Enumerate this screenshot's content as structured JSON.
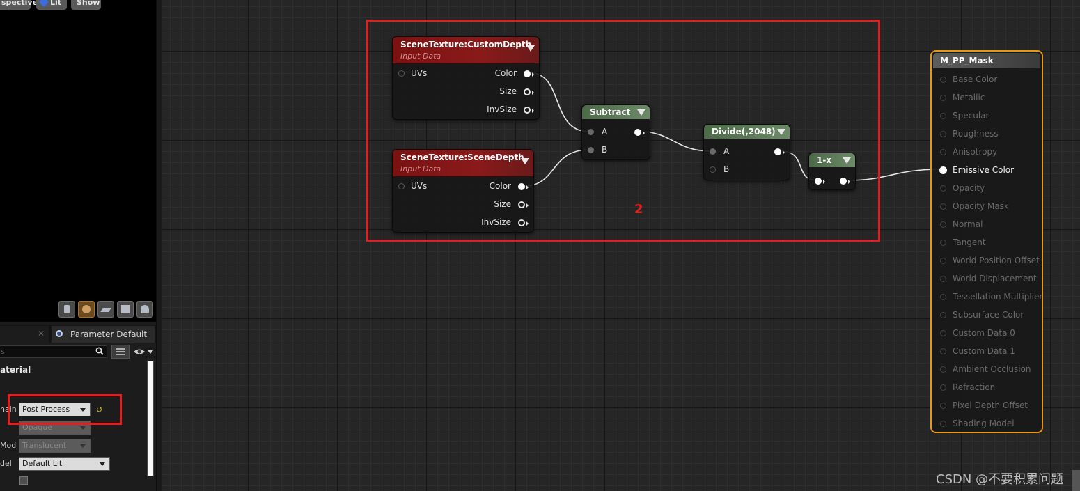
{
  "viewport": {
    "buttons": {
      "perspective": "spective",
      "lit": "Lit",
      "show": "Show"
    },
    "preview_shapes": [
      "cylinder-icon",
      "sphere-icon",
      "plane-icon",
      "cube-icon",
      "teapot-icon"
    ]
  },
  "details_panel": {
    "tab_param_label": "Parameter Default",
    "search_placeholder": "s",
    "section_heading": "aterial",
    "rows": [
      {
        "label": "nain",
        "value": "Post Process",
        "enabled": true
      },
      {
        "label": "",
        "value": "Opaque",
        "enabled": false
      },
      {
        "label": "Mod",
        "value": "Translucent",
        "enabled": false
      },
      {
        "label": "del",
        "value": "Default Lit",
        "enabled": true
      }
    ]
  },
  "graph": {
    "annotation_number": "2",
    "nodes": {
      "custom_depth": {
        "title": "SceneTexture:CustomDepth",
        "subtitle": "Input Data",
        "in_pins": [
          "UVs"
        ],
        "out_pins": [
          "Color",
          "Size",
          "InvSize"
        ]
      },
      "scene_depth": {
        "title": "SceneTexture:SceneDepth",
        "subtitle": "Input Data",
        "in_pins": [
          "UVs"
        ],
        "out_pins": [
          "Color",
          "Size",
          "InvSize"
        ]
      },
      "subtract": {
        "title": "Subtract",
        "in_pins": [
          "A",
          "B"
        ]
      },
      "divide": {
        "title": "Divide(,2048)",
        "in_pins": [
          "A",
          "B"
        ]
      },
      "one_minus": {
        "title": "1-x"
      }
    },
    "result_node": {
      "title": "M_PP_Mask",
      "pins": [
        "Base Color",
        "Metallic",
        "Specular",
        "Roughness",
        "Anisotropy",
        "Emissive Color",
        "Opacity",
        "Opacity Mask",
        "Normal",
        "Tangent",
        "World Position Offset",
        "World Displacement",
        "Tessellation Multiplier",
        "Subsurface Color",
        "Custom Data 0",
        "Custom Data 1",
        "Ambient Occlusion",
        "Refraction",
        "Pixel Depth Offset",
        "Shading Model"
      ],
      "active_pin": "Emissive Color"
    }
  },
  "watermark": "CSDN @不要积累问题",
  "colors": {
    "annotation_red": "#e02020",
    "result_border": "#e8951a",
    "texture_header": "#7a1212",
    "math_header": "#5c7a58"
  }
}
